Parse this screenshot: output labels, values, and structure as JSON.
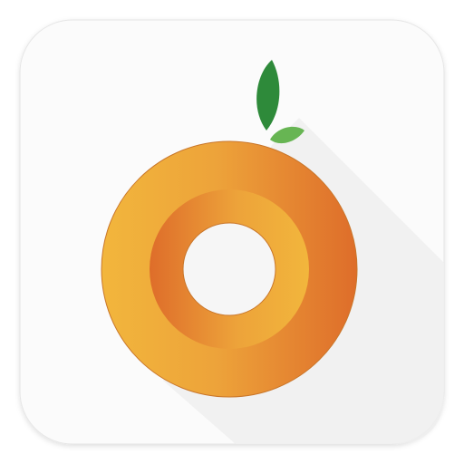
{
  "app_icon": {
    "icon": "orange-fruit-ring-icon",
    "colors": {
      "tile_background": "#fbfbfb",
      "tile_edge": "#e6e6e6",
      "long_shadow": "#efefef",
      "orange_light": "#f2b63c",
      "orange_mid": "#eda33a",
      "orange_dark": "#de6d2a",
      "ring_outline": "#c9762a",
      "leaf_dark": "#2e8a3a",
      "leaf_light": "#67b553",
      "center_hole": "#f6f6f6"
    }
  }
}
